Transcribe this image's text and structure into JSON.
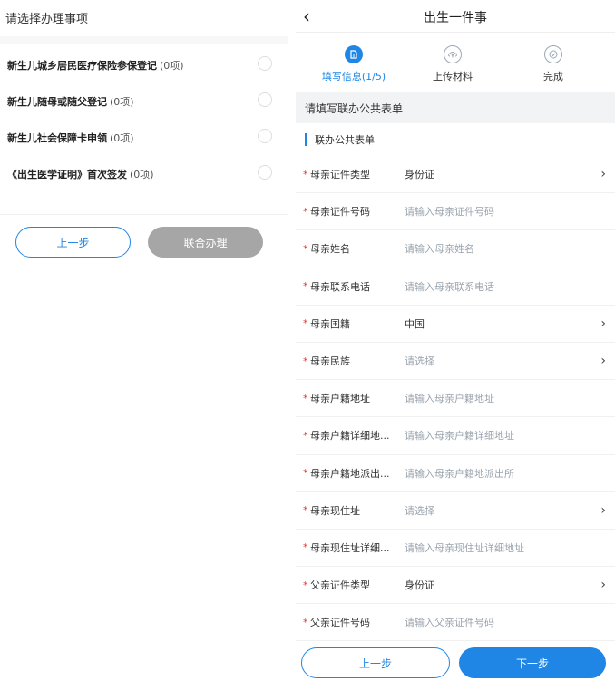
{
  "left": {
    "header": "请选择办理事项",
    "items": [
      {
        "label": "新生儿城乡居民医疗保险参保登记",
        "count": "(0项)"
      },
      {
        "label": "新生儿随母或随父登记",
        "count": "(0项)"
      },
      {
        "label": "新生儿社会保障卡申领",
        "count": "(0项)"
      },
      {
        "label": "《出生医学证明》首次签发",
        "count": "(0项)"
      }
    ],
    "prev_label": "上一步",
    "joint_label": "联合办理"
  },
  "right": {
    "title": "出生一件事",
    "back_glyph": "‹",
    "steps": [
      {
        "label": "填写信息(1/5)",
        "state": "active",
        "icon": "doc-icon"
      },
      {
        "label": "上传材料",
        "state": "inactive",
        "icon": "upload-icon"
      },
      {
        "label": "完成",
        "state": "inactive",
        "icon": "check-icon"
      }
    ],
    "banner": "请填写联办公共表单",
    "subhead": "联办公共表单",
    "fields": [
      {
        "label": "母亲证件类型",
        "value": "身份证",
        "placeholder": "",
        "chevron": true
      },
      {
        "label": "母亲证件号码",
        "value": "",
        "placeholder": "请输入母亲证件号码",
        "chevron": false
      },
      {
        "label": "母亲姓名",
        "value": "",
        "placeholder": "请输入母亲姓名",
        "chevron": false
      },
      {
        "label": "母亲联系电话",
        "value": "",
        "placeholder": "请输入母亲联系电话",
        "chevron": false
      },
      {
        "label": "母亲国籍",
        "value": "中国",
        "placeholder": "",
        "chevron": true
      },
      {
        "label": "母亲民族",
        "value": "",
        "placeholder": "请选择",
        "chevron": true
      },
      {
        "label": "母亲户籍地址",
        "value": "",
        "placeholder": "请输入母亲户籍地址",
        "chevron": false
      },
      {
        "label": "母亲户籍详细地...",
        "value": "",
        "placeholder": "请输入母亲户籍详细地址",
        "chevron": false
      },
      {
        "label": "母亲户籍地派出...",
        "value": "",
        "placeholder": "请输入母亲户籍地派出所",
        "chevron": false
      },
      {
        "label": "母亲现住址",
        "value": "",
        "placeholder": "请选择",
        "chevron": true
      },
      {
        "label": "母亲现住址详细...",
        "value": "",
        "placeholder": "请输入母亲现住址详细地址",
        "chevron": false
      },
      {
        "label": "父亲证件类型",
        "value": "身份证",
        "placeholder": "",
        "chevron": true
      },
      {
        "label": "父亲证件号码",
        "value": "",
        "placeholder": "请输入父亲证件号码",
        "chevron": false
      }
    ],
    "required_mark": "*",
    "chevron_glyph": "›",
    "prev_label": "上一步",
    "next_label": "下一步"
  },
  "colors": {
    "accent": "#1f86e6",
    "disabled_button": "#a6a6a6",
    "required": "#e23232"
  }
}
